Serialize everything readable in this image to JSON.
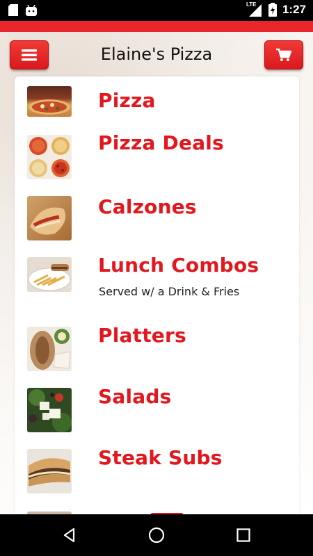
{
  "app": {
    "title": "Elaine's Pizza"
  },
  "status_bar": {
    "time": "1:27",
    "network": "LTE",
    "icons": [
      "sd-card-icon",
      "android-icon",
      "signal-icon",
      "battery-icon"
    ]
  },
  "header": {
    "menu_icon": "hamburger-icon",
    "cart_icon": "shopping-cart-icon"
  },
  "theme": {
    "accent": "#e3171e",
    "button": "#e8252b"
  },
  "menu": {
    "items": [
      {
        "title": "Pizza",
        "subtitle": ""
      },
      {
        "title": "Pizza Deals",
        "subtitle": ""
      },
      {
        "title": "Calzones",
        "subtitle": ""
      },
      {
        "title": "Lunch Combos",
        "subtitle": "Served w/ a Drink & Fries"
      },
      {
        "title": "Platters",
        "subtitle": ""
      },
      {
        "title": "Salads",
        "subtitle": ""
      },
      {
        "title": "Steak Subs",
        "subtitle": ""
      }
    ]
  },
  "nav_bar": {
    "buttons": [
      "back-icon",
      "home-icon",
      "recents-icon"
    ]
  }
}
